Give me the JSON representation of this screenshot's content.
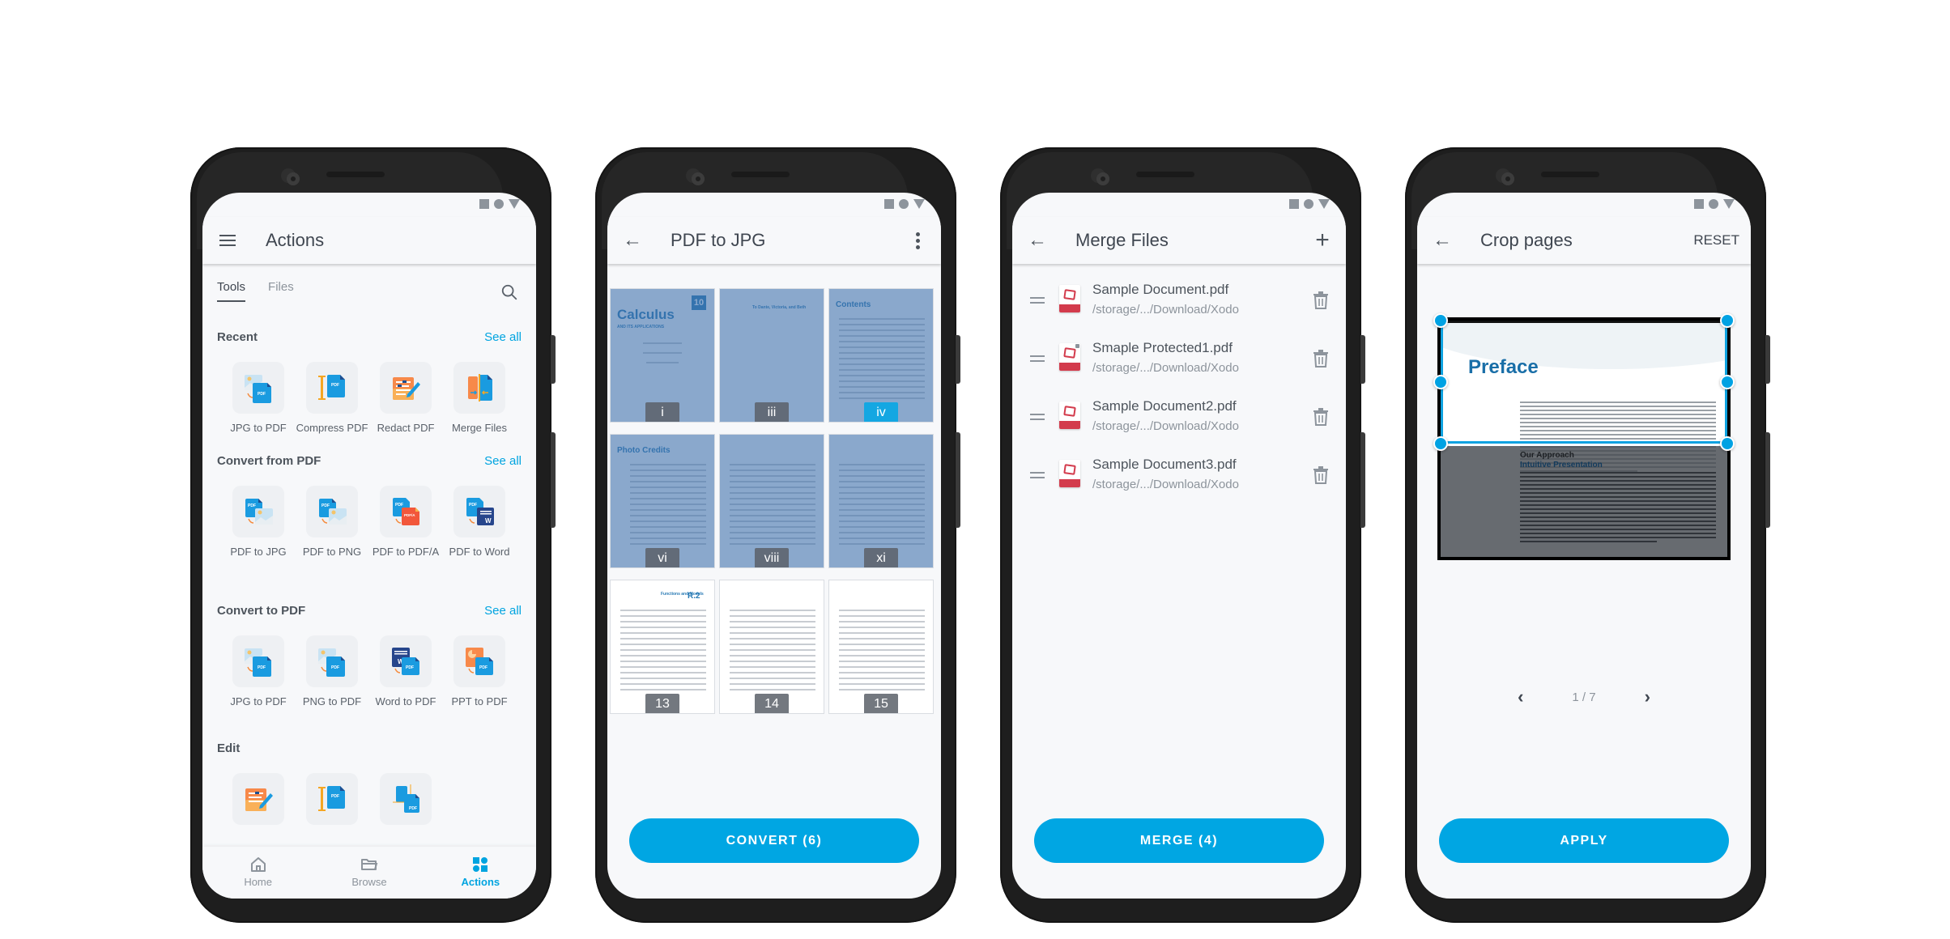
{
  "status_bar": {
    "icons": [
      "square-icon",
      "circle-icon",
      "triangle-icon"
    ]
  },
  "phones": {
    "actions": {
      "title": "Actions",
      "menu_icon": "hamburger-icon",
      "tabs": [
        {
          "label": "Tools",
          "active": true
        },
        {
          "label": "Files",
          "active": false
        }
      ],
      "search_icon": "search-icon",
      "sections": [
        {
          "title": "Recent",
          "see_all": "See all",
          "tools": [
            {
              "label": "JPG to PDF",
              "icon": "jpg-to-pdf-icon"
            },
            {
              "label": "Compress PDF",
              "icon": "compress-pdf-icon"
            },
            {
              "label": "Redact PDF",
              "icon": "redact-pdf-icon"
            },
            {
              "label": "Merge Files",
              "icon": "merge-files-icon"
            }
          ]
        },
        {
          "title": "Convert from PDF",
          "see_all": "See all",
          "tools": [
            {
              "label": "PDF to JPG",
              "icon": "pdf-to-jpg-icon"
            },
            {
              "label": "PDF to PNG",
              "icon": "pdf-to-png-icon"
            },
            {
              "label": "PDF to PDF/A",
              "icon": "pdf-to-pdfa-icon"
            },
            {
              "label": "PDF to Word",
              "icon": "pdf-to-word-icon"
            }
          ]
        },
        {
          "title": "Convert to PDF",
          "see_all": "See all",
          "tools": [
            {
              "label": "JPG to PDF",
              "icon": "jpg-to-pdf-icon"
            },
            {
              "label": "PNG to PDF",
              "icon": "png-to-pdf-icon"
            },
            {
              "label": "Word to PDF",
              "icon": "word-to-pdf-icon"
            },
            {
              "label": "PPT to PDF",
              "icon": "ppt-to-pdf-icon"
            }
          ]
        },
        {
          "title": "Edit",
          "see_all": "",
          "tools": [
            {
              "label": "",
              "icon": "redact-pdf-icon"
            },
            {
              "label": "",
              "icon": "compress-pdf-icon"
            },
            {
              "label": "",
              "icon": "crop-pdf-icon"
            }
          ]
        }
      ],
      "bottom_nav": [
        {
          "label": "Home",
          "icon": "home-icon",
          "active": false
        },
        {
          "label": "Browse",
          "icon": "folder-icon",
          "active": false
        },
        {
          "label": "Actions",
          "icon": "actions-grid-icon",
          "active": true
        }
      ]
    },
    "pdf_to_jpg": {
      "title": "PDF to JPG",
      "back_icon": "back-arrow-icon",
      "more_icon": "more-vert-icon",
      "pages": [
        {
          "label": "i",
          "selected": true,
          "highlight": false,
          "heading": "Calculus",
          "subheading": "AND ITS APPLICATIONS",
          "badge": "10"
        },
        {
          "label": "iii",
          "selected": true,
          "highlight": false,
          "heading": "",
          "subheading": "To Dante, Victoria, and Beth",
          "badge": ""
        },
        {
          "label": "iv",
          "selected": true,
          "highlight": true,
          "heading": "Contents",
          "subheading": "",
          "badge": ""
        },
        {
          "label": "vi",
          "selected": true,
          "highlight": false,
          "heading": "Photo Credits",
          "subheading": "",
          "badge": ""
        },
        {
          "label": "viii",
          "selected": true,
          "highlight": false,
          "heading": "",
          "subheading": "",
          "badge": ""
        },
        {
          "label": "xi",
          "selected": true,
          "highlight": false,
          "heading": "",
          "subheading": "",
          "badge": ""
        },
        {
          "label": "13",
          "selected": false,
          "highlight": false,
          "heading": "R.2",
          "subheading": "Functions and Models",
          "badge": ""
        },
        {
          "label": "14",
          "selected": false,
          "highlight": false,
          "heading": "",
          "subheading": "",
          "badge": ""
        },
        {
          "label": "15",
          "selected": false,
          "highlight": false,
          "heading": "",
          "subheading": "",
          "badge": ""
        }
      ],
      "convert_button": "CONVERT (6)"
    },
    "merge_files": {
      "title": "Merge Files",
      "back_icon": "back-arrow-icon",
      "add_icon": "plus-icon",
      "files": [
        {
          "name": "Sample Document.pdf",
          "path": "/storage/.../Download/Xodo",
          "locked": false
        },
        {
          "name": "Smaple Protected1.pdf",
          "path": "/storage/.../Download/Xodo",
          "locked": true
        },
        {
          "name": "Sample Document2.pdf",
          "path": "/storage/.../Download/Xodo",
          "locked": false
        },
        {
          "name": "Sample Document3.pdf",
          "path": "/storage/.../Download/Xodo",
          "locked": false
        }
      ],
      "merge_button": "MERGE (4)"
    },
    "crop_pages": {
      "title": "Crop pages",
      "back_icon": "back-arrow-icon",
      "reset_label": "RESET",
      "page_heading": "Preface",
      "section_heading": "Our Approach",
      "section_subheading": "Intuitive Presentation",
      "pager": {
        "current": 1,
        "total": 7,
        "text": "1 / 7"
      },
      "apply_button": "APPLY"
    }
  },
  "colors": {
    "accent": "#00a6e3",
    "text": "#3f4650",
    "muted": "#8d949c",
    "frame": "#1e1e1e",
    "screen_bg": "#f7f8fa",
    "pdf_red": "#d33b4c"
  }
}
